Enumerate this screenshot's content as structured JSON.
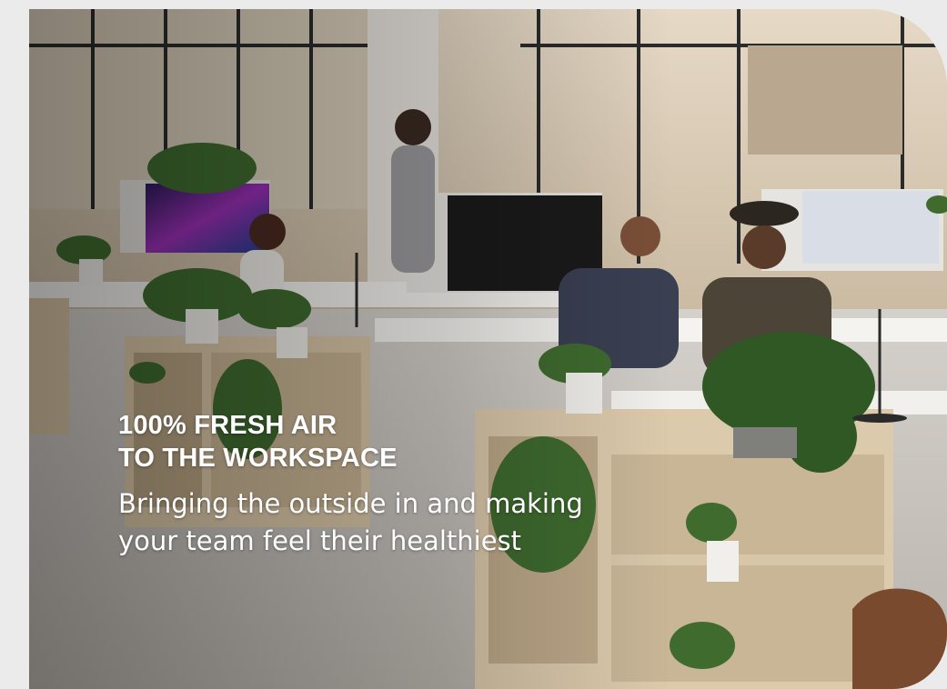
{
  "hero": {
    "headline_lines": [
      "100% FRESH AIR",
      "TO THE WORKSPACE"
    ],
    "subline_lines": [
      "Bringing the outside in and making",
      "your team feel their healthiest"
    ]
  },
  "colors": {
    "page_background": "#ebebeb",
    "text": "#ffffff",
    "floor": "#cfcac4",
    "desk_wood": "#d9c6a7",
    "plant_green": "#3f6b2f"
  },
  "icons": [
    "office-photo"
  ]
}
